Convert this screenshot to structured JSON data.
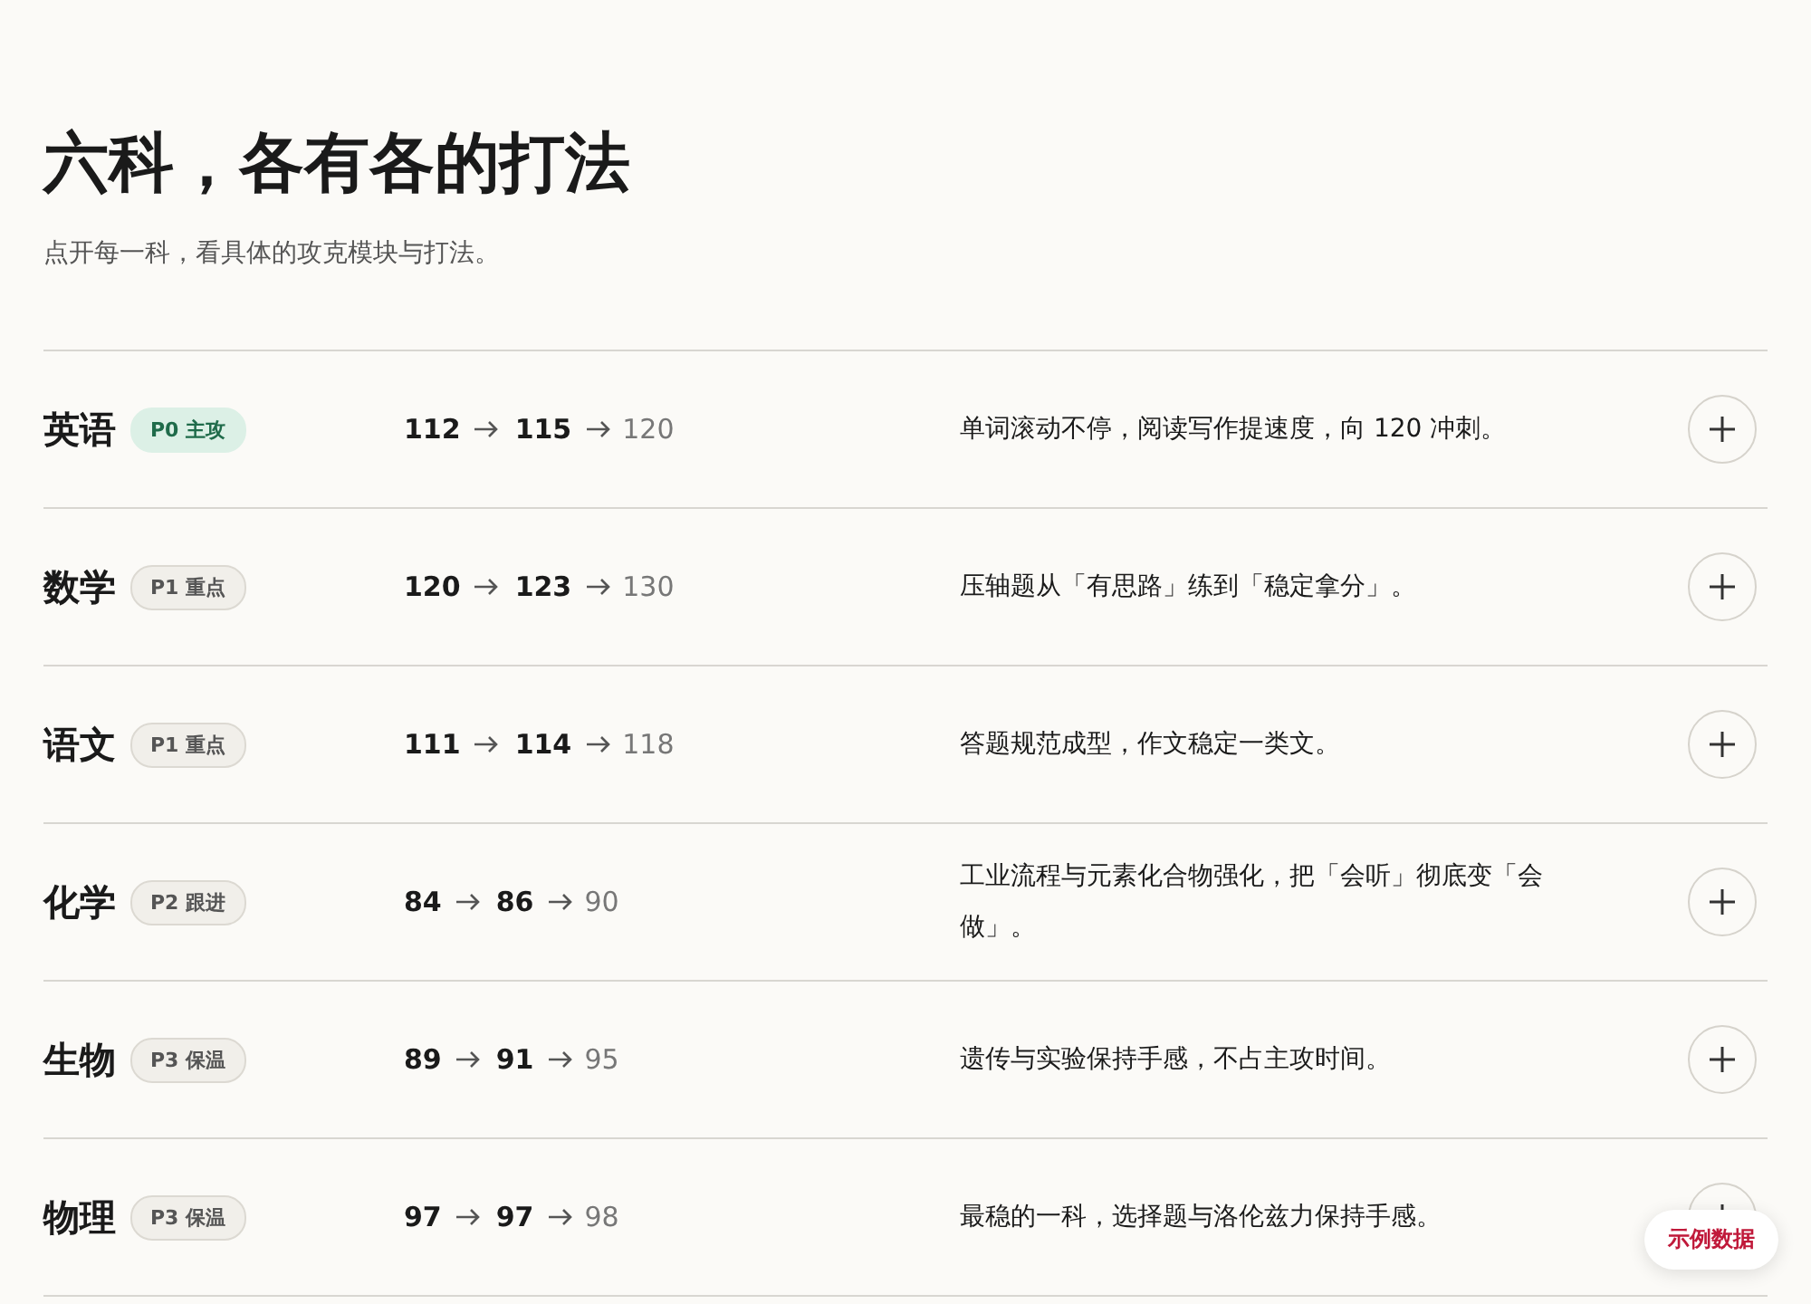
{
  "header": {
    "title": "六科，各有各的打法",
    "subtitle": "点开每一科，看具体的攻克模块与打法。"
  },
  "subjects": [
    {
      "name": "英语",
      "badge": "P0 主攻",
      "kind": "primary",
      "scores": [
        "112",
        "115",
        "120"
      ],
      "note": "单词滚动不停，阅读写作提速度，向 120 冲刺。",
      "expanded": false
    },
    {
      "name": "数学",
      "badge": "P1 重点",
      "kind": "normal",
      "scores": [
        "120",
        "123",
        "130"
      ],
      "note": "压轴题从「有思路」练到「稳定拿分」。",
      "expanded": false
    },
    {
      "name": "语文",
      "badge": "P1 重点",
      "kind": "normal",
      "scores": [
        "111",
        "114",
        "118"
      ],
      "note": "答题规范成型，作文稳定一类文。",
      "expanded": false
    },
    {
      "name": "化学",
      "badge": "P2 跟进",
      "kind": "normal",
      "scores": [
        "84",
        "86",
        "90"
      ],
      "note": "工业流程与元素化合物强化，把「会听」彻底变「会做」。",
      "expanded": false
    },
    {
      "name": "生物",
      "badge": "P3 保温",
      "kind": "normal",
      "scores": [
        "89",
        "91",
        "95"
      ],
      "note": "遗传与实验保持手感，不占主攻时间。",
      "expanded": false
    },
    {
      "name": "物理",
      "badge": "P3 保温",
      "kind": "normal",
      "scores": [
        "97",
        "97",
        "98"
      ],
      "note": "最稳的一科，选择题与洛伦兹力保持手感。",
      "expanded": false
    }
  ],
  "sample_tag": "示例数据"
}
